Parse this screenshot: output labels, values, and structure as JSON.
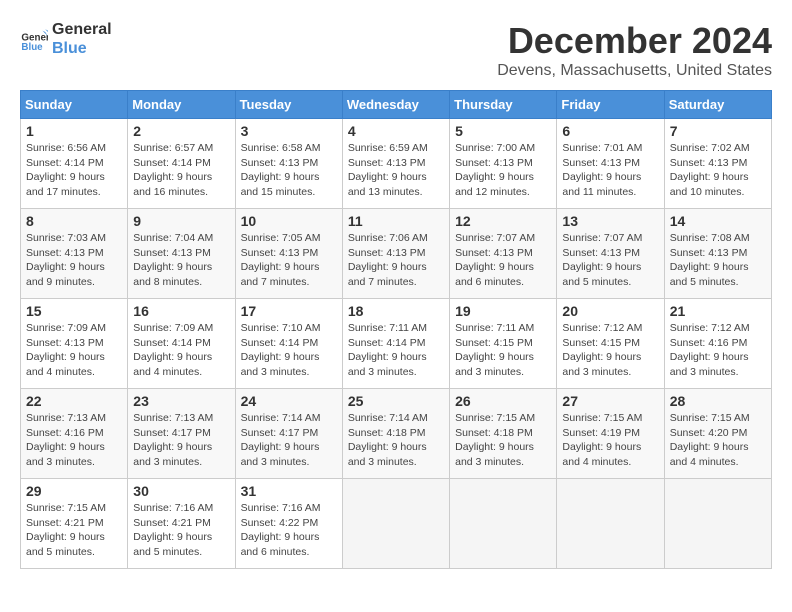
{
  "header": {
    "logo_line1": "General",
    "logo_line2": "Blue",
    "month_title": "December 2024",
    "location": "Devens, Massachusetts, United States"
  },
  "weekdays": [
    "Sunday",
    "Monday",
    "Tuesday",
    "Wednesday",
    "Thursday",
    "Friday",
    "Saturday"
  ],
  "weeks": [
    [
      {
        "day": "1",
        "sunrise": "6:56 AM",
        "sunset": "4:14 PM",
        "daylight": "9 hours and 17 minutes."
      },
      {
        "day": "2",
        "sunrise": "6:57 AM",
        "sunset": "4:14 PM",
        "daylight": "9 hours and 16 minutes."
      },
      {
        "day": "3",
        "sunrise": "6:58 AM",
        "sunset": "4:13 PM",
        "daylight": "9 hours and 15 minutes."
      },
      {
        "day": "4",
        "sunrise": "6:59 AM",
        "sunset": "4:13 PM",
        "daylight": "9 hours and 13 minutes."
      },
      {
        "day": "5",
        "sunrise": "7:00 AM",
        "sunset": "4:13 PM",
        "daylight": "9 hours and 12 minutes."
      },
      {
        "day": "6",
        "sunrise": "7:01 AM",
        "sunset": "4:13 PM",
        "daylight": "9 hours and 11 minutes."
      },
      {
        "day": "7",
        "sunrise": "7:02 AM",
        "sunset": "4:13 PM",
        "daylight": "9 hours and 10 minutes."
      }
    ],
    [
      {
        "day": "8",
        "sunrise": "7:03 AM",
        "sunset": "4:13 PM",
        "daylight": "9 hours and 9 minutes."
      },
      {
        "day": "9",
        "sunrise": "7:04 AM",
        "sunset": "4:13 PM",
        "daylight": "9 hours and 8 minutes."
      },
      {
        "day": "10",
        "sunrise": "7:05 AM",
        "sunset": "4:13 PM",
        "daylight": "9 hours and 7 minutes."
      },
      {
        "day": "11",
        "sunrise": "7:06 AM",
        "sunset": "4:13 PM",
        "daylight": "9 hours and 7 minutes."
      },
      {
        "day": "12",
        "sunrise": "7:07 AM",
        "sunset": "4:13 PM",
        "daylight": "9 hours and 6 minutes."
      },
      {
        "day": "13",
        "sunrise": "7:07 AM",
        "sunset": "4:13 PM",
        "daylight": "9 hours and 5 minutes."
      },
      {
        "day": "14",
        "sunrise": "7:08 AM",
        "sunset": "4:13 PM",
        "daylight": "9 hours and 5 minutes."
      }
    ],
    [
      {
        "day": "15",
        "sunrise": "7:09 AM",
        "sunset": "4:13 PM",
        "daylight": "9 hours and 4 minutes."
      },
      {
        "day": "16",
        "sunrise": "7:09 AM",
        "sunset": "4:14 PM",
        "daylight": "9 hours and 4 minutes."
      },
      {
        "day": "17",
        "sunrise": "7:10 AM",
        "sunset": "4:14 PM",
        "daylight": "9 hours and 3 minutes."
      },
      {
        "day": "18",
        "sunrise": "7:11 AM",
        "sunset": "4:14 PM",
        "daylight": "9 hours and 3 minutes."
      },
      {
        "day": "19",
        "sunrise": "7:11 AM",
        "sunset": "4:15 PM",
        "daylight": "9 hours and 3 minutes."
      },
      {
        "day": "20",
        "sunrise": "7:12 AM",
        "sunset": "4:15 PM",
        "daylight": "9 hours and 3 minutes."
      },
      {
        "day": "21",
        "sunrise": "7:12 AM",
        "sunset": "4:16 PM",
        "daylight": "9 hours and 3 minutes."
      }
    ],
    [
      {
        "day": "22",
        "sunrise": "7:13 AM",
        "sunset": "4:16 PM",
        "daylight": "9 hours and 3 minutes."
      },
      {
        "day": "23",
        "sunrise": "7:13 AM",
        "sunset": "4:17 PM",
        "daylight": "9 hours and 3 minutes."
      },
      {
        "day": "24",
        "sunrise": "7:14 AM",
        "sunset": "4:17 PM",
        "daylight": "9 hours and 3 minutes."
      },
      {
        "day": "25",
        "sunrise": "7:14 AM",
        "sunset": "4:18 PM",
        "daylight": "9 hours and 3 minutes."
      },
      {
        "day": "26",
        "sunrise": "7:15 AM",
        "sunset": "4:18 PM",
        "daylight": "9 hours and 3 minutes."
      },
      {
        "day": "27",
        "sunrise": "7:15 AM",
        "sunset": "4:19 PM",
        "daylight": "9 hours and 4 minutes."
      },
      {
        "day": "28",
        "sunrise": "7:15 AM",
        "sunset": "4:20 PM",
        "daylight": "9 hours and 4 minutes."
      }
    ],
    [
      {
        "day": "29",
        "sunrise": "7:15 AM",
        "sunset": "4:21 PM",
        "daylight": "9 hours and 5 minutes."
      },
      {
        "day": "30",
        "sunrise": "7:16 AM",
        "sunset": "4:21 PM",
        "daylight": "9 hours and 5 minutes."
      },
      {
        "day": "31",
        "sunrise": "7:16 AM",
        "sunset": "4:22 PM",
        "daylight": "9 hours and 6 minutes."
      },
      null,
      null,
      null,
      null
    ]
  ],
  "labels": {
    "sunrise_prefix": "Sunrise: ",
    "sunset_prefix": "Sunset: ",
    "daylight_prefix": "Daylight: "
  }
}
